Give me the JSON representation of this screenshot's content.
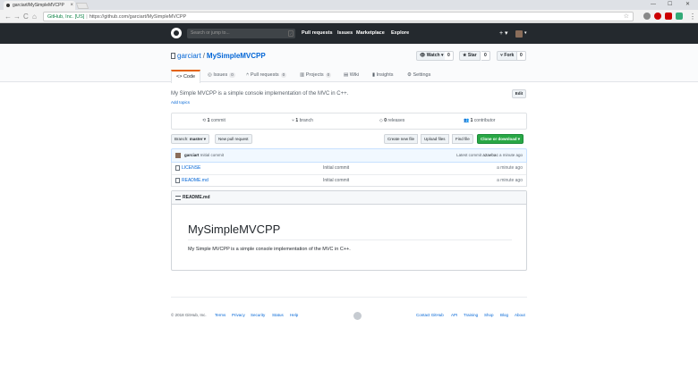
{
  "browser": {
    "tab_title": "garciart/MySimpleMVCPP",
    "tab_close": "×",
    "min": "—",
    "max": "☐",
    "close": "✕",
    "back": "←",
    "forward": "→",
    "reload": "C",
    "home": "⌂",
    "lock": "🔒",
    "site_identity": "GitHub, Inc. [US]",
    "url": "https://github.com/garciart/MySimpleMVCPP",
    "star": "☆",
    "menu": "⋮"
  },
  "gh_header": {
    "search_placeholder": "Search or jump to...",
    "search_slash": "/",
    "nav": [
      "Pull requests",
      "Issues",
      "Marketplace",
      "Explore"
    ],
    "bell": "🔔",
    "plus": "+ ▾",
    "avatar_caret": "▾"
  },
  "repo": {
    "owner": "garciart",
    "slash": "/",
    "name": "MySimpleMVCPP",
    "watch_label": "👁 Watch ▾",
    "watch_count": "0",
    "star_label": "★ Star",
    "star_count": "0",
    "fork_label": "⑂ Fork",
    "fork_count": "0",
    "tabs": {
      "code": "<> Code",
      "issues": "Issues",
      "issues_count": "0",
      "pulls": "Pull requests",
      "pulls_count": "0",
      "projects": "Projects",
      "projects_count": "0",
      "wiki": "Wiki",
      "insights": "Insights",
      "settings": "Settings"
    },
    "description": "My Simple MVCPP is a simple console implementation of the MVC in C++.",
    "add_topics": "Add topics",
    "edit_label": "Edit",
    "summary": {
      "commits_num": "1",
      "commits_label": "commit",
      "branches_num": "1",
      "branches_label": "branch",
      "releases_num": "0",
      "releases_label": "releases",
      "contributors_num": "1",
      "contributors_label": "contributor"
    },
    "branch_label": "Branch:",
    "branch_value": "master ▾",
    "new_pr": "New pull request",
    "create_file": "Create new file",
    "upload_files": "Upload files",
    "find_file": "Find file",
    "clone": "Clone or download ▾",
    "latest_commit": {
      "author": "garciart",
      "message": "Initial commit",
      "prefix": "Latest commit",
      "sha": "a2aebac",
      "age": "a minute ago"
    },
    "files": [
      {
        "name": "LICENSE",
        "message": "Initial commit",
        "age": "a minute ago"
      },
      {
        "name": "README.md",
        "message": "Initial commit",
        "age": "a minute ago"
      }
    ],
    "readme": {
      "header": "README.md",
      "title": "MySimpleMVCPP",
      "body": "My Simple MVCPP is a simple console implementation of the MVC in C++."
    }
  },
  "footer": {
    "copyright": "© 2018 GitHub, Inc.",
    "left_links": [
      "Terms",
      "Privacy",
      "Security",
      "Status",
      "Help"
    ],
    "right_links": [
      "Contact GitHub",
      "API",
      "Training",
      "Shop",
      "Blog",
      "About"
    ]
  },
  "colors": {
    "header_bg": "#24292e",
    "accent": "#0366d6",
    "clone_green": "#28a745",
    "lang_bar": "#f1e05a",
    "tab_underline": "#e36209"
  }
}
